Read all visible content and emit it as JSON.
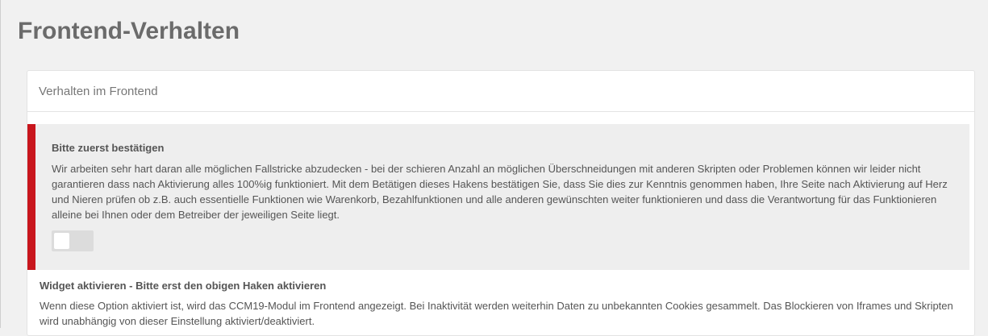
{
  "page": {
    "title": "Frontend-Verhalten"
  },
  "panel": {
    "header": "Verhalten im Frontend",
    "alert": {
      "title": "Bitte zuerst bestätigen",
      "text": "Wir arbeiten sehr hart daran alle möglichen Fallstricke abzudecken - bei der schieren Anzahl an möglichen Überschneidungen mit anderen Skripten oder Problemen können wir leider nicht garantieren dass nach Aktivierung alles 100%ig funktioniert. Mit dem Betätigen dieses Hakens bestätigen Sie, dass Sie dies zur Kenntnis genommen haben, Ihre Seite nach Aktivierung auf Herz und Nieren prüfen ob z.B. auch essentielle Funktionen wie Warenkorb, Bezahlfunktionen und alle anderen gewünschten weiter funktionieren und dass die Verantwortung für das Funktionieren alleine bei Ihnen oder dem Betreiber der jeweiligen Seite liegt.",
      "accent_color": "#c8161d",
      "toggle_on": false
    },
    "widget_option": {
      "title": "Widget aktivieren - Bitte erst den obigen Haken aktivieren",
      "text": "Wenn diese Option aktiviert ist, wird das CCM19-Modul im Frontend angezeigt. Bei Inaktivität werden weiterhin Daten zu unbekannten Cookies gesammelt. Das Blockieren von Iframes und Skripten wird unabhängig von dieser Einstellung aktiviert/deaktiviert."
    }
  }
}
